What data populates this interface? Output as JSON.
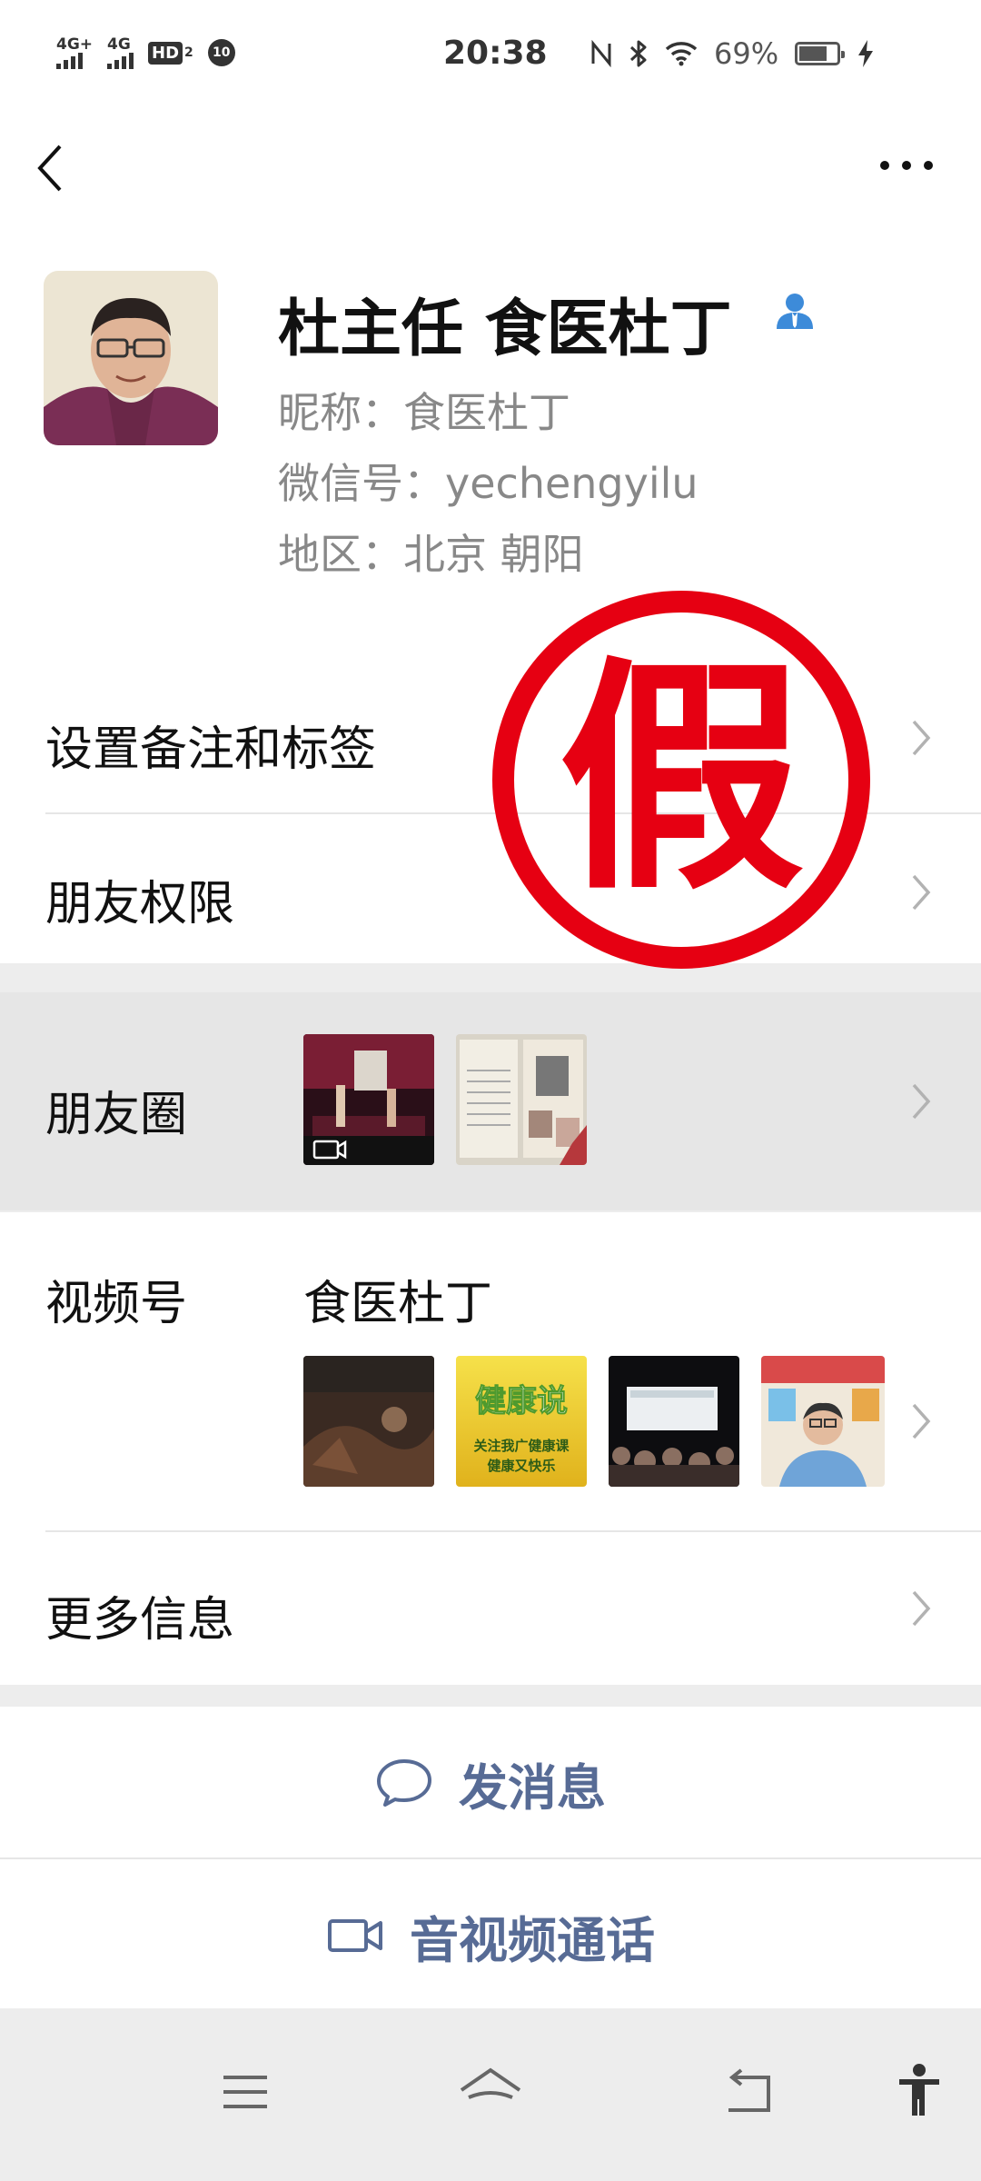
{
  "status_bar": {
    "time": "20:38",
    "signal_1": "4G+",
    "signal_2": "4G",
    "hd": "HD",
    "hd_sub": "2",
    "badge": "10",
    "battery_percent": "69%",
    "battery_level": 0.69,
    "icons": [
      "nfc-icon",
      "bluetooth-icon",
      "wifi-icon",
      "battery-icon",
      "charging-icon"
    ]
  },
  "profile": {
    "name": "杜主任 食医杜丁",
    "nickname": "昵称：食医杜丁",
    "wechat_id": "微信号：yechengyilu",
    "region": "地区：北京  朝阳"
  },
  "stamp_text": "假",
  "rows": {
    "remark": "设置备注和标签",
    "permissions": "朋友权限",
    "moments": "朋友圈",
    "channels": "视频号",
    "channels_name": "食医杜丁",
    "more_info": "更多信息"
  },
  "channel_thumb_texts": {
    "t2_big": "健康说",
    "t2_small_1": "关注我广健康课",
    "t2_small_2": "健康又快乐"
  },
  "actions": {
    "message": "发消息",
    "call": "音视频通话"
  },
  "colors": {
    "link_blue": "#576b95",
    "stamp_red": "#e60012",
    "background": "#ededed"
  }
}
